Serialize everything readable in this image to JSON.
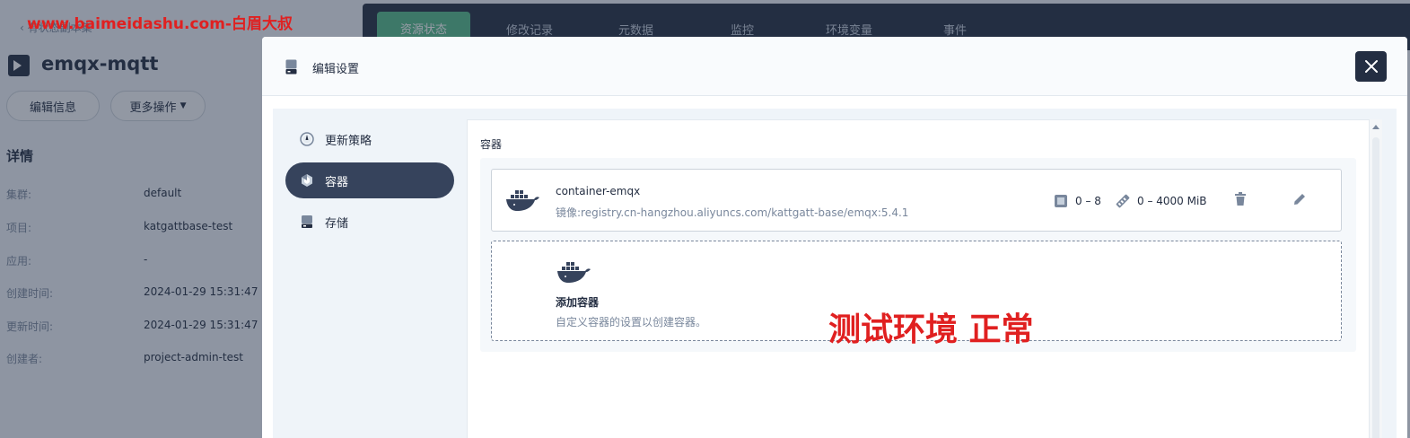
{
  "watermark": "www.baimeidashu.com-白眉大叔",
  "overlay_text": "测试环境 正常",
  "background": {
    "back_link": "有状态副本集",
    "app_title": "emqx-mqtt",
    "buttons": {
      "edit_info": "编辑信息",
      "more_actions": "更多操作"
    },
    "tabs": [
      "资源状态",
      "修改记录",
      "元数据",
      "监控",
      "环境变量",
      "事件"
    ],
    "details": {
      "title": "详情",
      "rows": [
        {
          "label": "集群:",
          "value": "default"
        },
        {
          "label": "项目:",
          "value": "katgattbase-test"
        },
        {
          "label": "应用:",
          "value": "-"
        },
        {
          "label": "创建时间:",
          "value": "2024-01-29 15:31:47"
        },
        {
          "label": "更新时间:",
          "value": "2024-01-29 15:31:47"
        },
        {
          "label": "创建者:",
          "value": "project-admin-test"
        }
      ]
    }
  },
  "modal": {
    "title": "编辑设置",
    "nav": [
      {
        "label": "更新策略",
        "icon": "update-strategy-icon",
        "active": false
      },
      {
        "label": "容器",
        "icon": "container-icon",
        "active": true
      },
      {
        "label": "存储",
        "icon": "storage-icon",
        "active": false
      }
    ],
    "section_label": "容器",
    "container": {
      "name": "container-emqx",
      "image_label": "镜像:",
      "image": "registry.cn-hangzhou.aliyuncs.com/kattgatt-base/emqx:5.4.1",
      "cpu": "0 – 8",
      "memory": "0 – 4000 MiB"
    },
    "add_container": {
      "title": "添加容器",
      "description": "自定义容器的设置以创建容器。"
    }
  },
  "colors": {
    "primary_dark": "#242e42",
    "active_nav": "#36435c",
    "tab_active": "#55bc8a",
    "watermark": "#e02020"
  }
}
